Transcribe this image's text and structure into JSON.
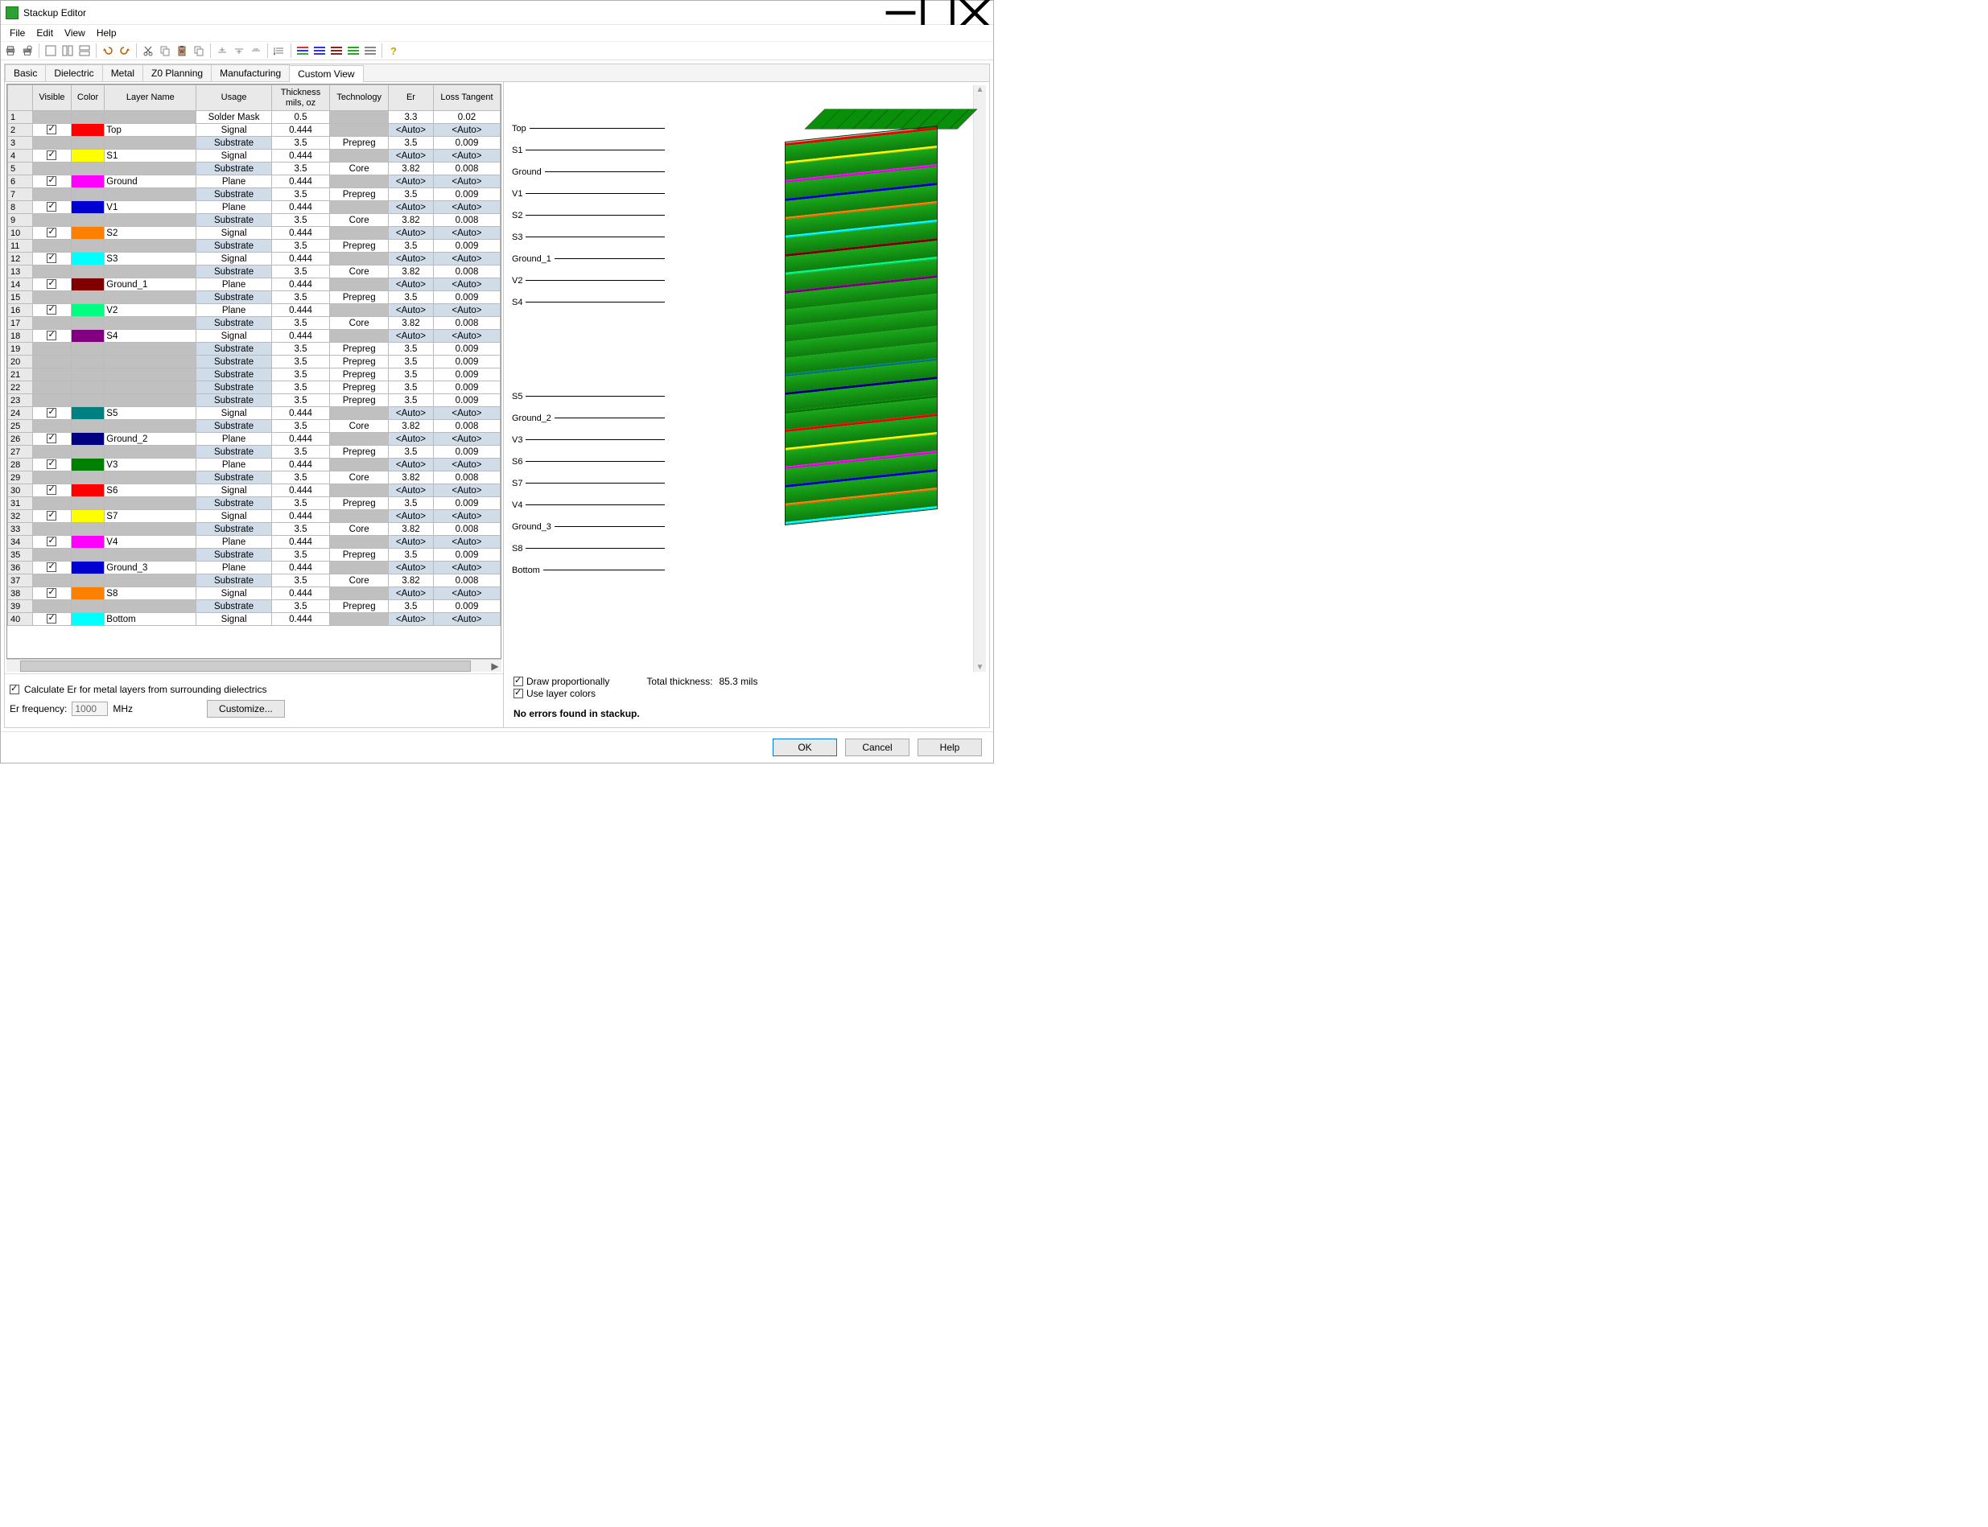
{
  "window": {
    "title": "Stackup Editor"
  },
  "menubar": [
    "File",
    "Edit",
    "View",
    "Help"
  ],
  "tabs": [
    "Basic",
    "Dielectric",
    "Metal",
    "Z0 Planning",
    "Manufacturing",
    "Custom View"
  ],
  "activeTab": 5,
  "columns": [
    "",
    "Visible",
    "Color",
    "Layer Name",
    "Usage",
    "Thickness\nmils, oz",
    "Technology",
    "Er",
    "Loss Tangent"
  ],
  "rows": [
    {
      "n": 1,
      "vis": null,
      "color": null,
      "name": "",
      "usage": "Solder Mask",
      "th": "0.5",
      "tech": "",
      "er": "3.3",
      "lt": "0.02",
      "kind": "mask"
    },
    {
      "n": 2,
      "vis": true,
      "color": "#ff0000",
      "name": "Top",
      "usage": "Signal",
      "th": "0.444",
      "tech": "",
      "er": "<Auto>",
      "lt": "<Auto>",
      "kind": "metal"
    },
    {
      "n": 3,
      "vis": null,
      "color": null,
      "name": "",
      "usage": "Substrate",
      "th": "3.5",
      "tech": "Prepreg",
      "er": "3.5",
      "lt": "0.009",
      "kind": "sub"
    },
    {
      "n": 4,
      "vis": true,
      "color": "#ffff00",
      "name": "S1",
      "usage": "Signal",
      "th": "0.444",
      "tech": "",
      "er": "<Auto>",
      "lt": "<Auto>",
      "kind": "metal"
    },
    {
      "n": 5,
      "vis": null,
      "color": null,
      "name": "",
      "usage": "Substrate",
      "th": "3.5",
      "tech": "Core",
      "er": "3.82",
      "lt": "0.008",
      "kind": "sub"
    },
    {
      "n": 6,
      "vis": true,
      "color": "#ff00ff",
      "name": "Ground",
      "usage": "Plane",
      "th": "0.444",
      "tech": "",
      "er": "<Auto>",
      "lt": "<Auto>",
      "kind": "metal"
    },
    {
      "n": 7,
      "vis": null,
      "color": null,
      "name": "",
      "usage": "Substrate",
      "th": "3.5",
      "tech": "Prepreg",
      "er": "3.5",
      "lt": "0.009",
      "kind": "sub"
    },
    {
      "n": 8,
      "vis": true,
      "color": "#0000d0",
      "name": "V1",
      "usage": "Plane",
      "th": "0.444",
      "tech": "",
      "er": "<Auto>",
      "lt": "<Auto>",
      "kind": "metal"
    },
    {
      "n": 9,
      "vis": null,
      "color": null,
      "name": "",
      "usage": "Substrate",
      "th": "3.5",
      "tech": "Core",
      "er": "3.82",
      "lt": "0.008",
      "kind": "sub"
    },
    {
      "n": 10,
      "vis": true,
      "color": "#ff8000",
      "name": "S2",
      "usage": "Signal",
      "th": "0.444",
      "tech": "",
      "er": "<Auto>",
      "lt": "<Auto>",
      "kind": "metal"
    },
    {
      "n": 11,
      "vis": null,
      "color": null,
      "name": "",
      "usage": "Substrate",
      "th": "3.5",
      "tech": "Prepreg",
      "er": "3.5",
      "lt": "0.009",
      "kind": "sub"
    },
    {
      "n": 12,
      "vis": true,
      "color": "#00ffff",
      "name": "S3",
      "usage": "Signal",
      "th": "0.444",
      "tech": "",
      "er": "<Auto>",
      "lt": "<Auto>",
      "kind": "metal"
    },
    {
      "n": 13,
      "vis": null,
      "color": null,
      "name": "",
      "usage": "Substrate",
      "th": "3.5",
      "tech": "Core",
      "er": "3.82",
      "lt": "0.008",
      "kind": "sub"
    },
    {
      "n": 14,
      "vis": true,
      "color": "#800000",
      "name": "Ground_1",
      "usage": "Plane",
      "th": "0.444",
      "tech": "",
      "er": "<Auto>",
      "lt": "<Auto>",
      "kind": "metal"
    },
    {
      "n": 15,
      "vis": null,
      "color": null,
      "name": "",
      "usage": "Substrate",
      "th": "3.5",
      "tech": "Prepreg",
      "er": "3.5",
      "lt": "0.009",
      "kind": "sub"
    },
    {
      "n": 16,
      "vis": true,
      "color": "#00ff80",
      "name": "V2",
      "usage": "Plane",
      "th": "0.444",
      "tech": "",
      "er": "<Auto>",
      "lt": "<Auto>",
      "kind": "metal"
    },
    {
      "n": 17,
      "vis": null,
      "color": null,
      "name": "",
      "usage": "Substrate",
      "th": "3.5",
      "tech": "Core",
      "er": "3.82",
      "lt": "0.008",
      "kind": "sub"
    },
    {
      "n": 18,
      "vis": true,
      "color": "#800080",
      "name": "S4",
      "usage": "Signal",
      "th": "0.444",
      "tech": "",
      "er": "<Auto>",
      "lt": "<Auto>",
      "kind": "metal"
    },
    {
      "n": 19,
      "vis": null,
      "color": null,
      "name": "",
      "usage": "Substrate",
      "th": "3.5",
      "tech": "Prepreg",
      "er": "3.5",
      "lt": "0.009",
      "kind": "sub"
    },
    {
      "n": 20,
      "vis": null,
      "color": null,
      "name": "",
      "usage": "Substrate",
      "th": "3.5",
      "tech": "Prepreg",
      "er": "3.5",
      "lt": "0.009",
      "kind": "sub"
    },
    {
      "n": 21,
      "vis": null,
      "color": null,
      "name": "",
      "usage": "Substrate",
      "th": "3.5",
      "tech": "Prepreg",
      "er": "3.5",
      "lt": "0.009",
      "kind": "sub"
    },
    {
      "n": 22,
      "vis": null,
      "color": null,
      "name": "",
      "usage": "Substrate",
      "th": "3.5",
      "tech": "Prepreg",
      "er": "3.5",
      "lt": "0.009",
      "kind": "sub"
    },
    {
      "n": 23,
      "vis": null,
      "color": null,
      "name": "",
      "usage": "Substrate",
      "th": "3.5",
      "tech": "Prepreg",
      "er": "3.5",
      "lt": "0.009",
      "kind": "sub"
    },
    {
      "n": 24,
      "vis": true,
      "color": "#008080",
      "name": "S5",
      "usage": "Signal",
      "th": "0.444",
      "tech": "",
      "er": "<Auto>",
      "lt": "<Auto>",
      "kind": "metal"
    },
    {
      "n": 25,
      "vis": null,
      "color": null,
      "name": "",
      "usage": "Substrate",
      "th": "3.5",
      "tech": "Core",
      "er": "3.82",
      "lt": "0.008",
      "kind": "sub"
    },
    {
      "n": 26,
      "vis": true,
      "color": "#000080",
      "name": "Ground_2",
      "usage": "Plane",
      "th": "0.444",
      "tech": "",
      "er": "<Auto>",
      "lt": "<Auto>",
      "kind": "metal"
    },
    {
      "n": 27,
      "vis": null,
      "color": null,
      "name": "",
      "usage": "Substrate",
      "th": "3.5",
      "tech": "Prepreg",
      "er": "3.5",
      "lt": "0.009",
      "kind": "sub"
    },
    {
      "n": 28,
      "vis": true,
      "color": "#008000",
      "name": "V3",
      "usage": "Plane",
      "th": "0.444",
      "tech": "",
      "er": "<Auto>",
      "lt": "<Auto>",
      "kind": "metal"
    },
    {
      "n": 29,
      "vis": null,
      "color": null,
      "name": "",
      "usage": "Substrate",
      "th": "3.5",
      "tech": "Core",
      "er": "3.82",
      "lt": "0.008",
      "kind": "sub"
    },
    {
      "n": 30,
      "vis": true,
      "color": "#ff0000",
      "name": "S6",
      "usage": "Signal",
      "th": "0.444",
      "tech": "",
      "er": "<Auto>",
      "lt": "<Auto>",
      "kind": "metal"
    },
    {
      "n": 31,
      "vis": null,
      "color": null,
      "name": "",
      "usage": "Substrate",
      "th": "3.5",
      "tech": "Prepreg",
      "er": "3.5",
      "lt": "0.009",
      "kind": "sub"
    },
    {
      "n": 32,
      "vis": true,
      "color": "#ffff00",
      "name": "S7",
      "usage": "Signal",
      "th": "0.444",
      "tech": "",
      "er": "<Auto>",
      "lt": "<Auto>",
      "kind": "metal"
    },
    {
      "n": 33,
      "vis": null,
      "color": null,
      "name": "",
      "usage": "Substrate",
      "th": "3.5",
      "tech": "Core",
      "er": "3.82",
      "lt": "0.008",
      "kind": "sub"
    },
    {
      "n": 34,
      "vis": true,
      "color": "#ff00ff",
      "name": "V4",
      "usage": "Plane",
      "th": "0.444",
      "tech": "",
      "er": "<Auto>",
      "lt": "<Auto>",
      "kind": "metal"
    },
    {
      "n": 35,
      "vis": null,
      "color": null,
      "name": "",
      "usage": "Substrate",
      "th": "3.5",
      "tech": "Prepreg",
      "er": "3.5",
      "lt": "0.009",
      "kind": "sub"
    },
    {
      "n": 36,
      "vis": true,
      "color": "#0000d0",
      "name": "Ground_3",
      "usage": "Plane",
      "th": "0.444",
      "tech": "",
      "er": "<Auto>",
      "lt": "<Auto>",
      "kind": "metal"
    },
    {
      "n": 37,
      "vis": null,
      "color": null,
      "name": "",
      "usage": "Substrate",
      "th": "3.5",
      "tech": "Core",
      "er": "3.82",
      "lt": "0.008",
      "kind": "sub"
    },
    {
      "n": 38,
      "vis": true,
      "color": "#ff8000",
      "name": "S8",
      "usage": "Signal",
      "th": "0.444",
      "tech": "",
      "er": "<Auto>",
      "lt": "<Auto>",
      "kind": "metal"
    },
    {
      "n": 39,
      "vis": null,
      "color": null,
      "name": "",
      "usage": "Substrate",
      "th": "3.5",
      "tech": "Prepreg",
      "er": "3.5",
      "lt": "0.009",
      "kind": "sub"
    },
    {
      "n": 40,
      "vis": true,
      "color": "#00ffff",
      "name": "Bottom",
      "usage": "Signal",
      "th": "0.444",
      "tech": "",
      "er": "<Auto>",
      "lt": "<Auto>",
      "kind": "metal"
    }
  ],
  "footer": {
    "calcEr_label": "Calculate Er for metal layers from surrounding dielectrics",
    "calcEr_checked": true,
    "erfreq_label": "Er frequency:",
    "erfreq_value": "1000",
    "erfreq_unit": "MHz",
    "customize_label": "Customize..."
  },
  "right": {
    "drawprop_label": "Draw proportionally",
    "drawprop_checked": true,
    "uselayer_label": "Use layer colors",
    "uselayer_checked": true,
    "totalthick_label": "Total thickness:",
    "totalthick_value": "85.3 mils",
    "status": "No errors found in stackup."
  },
  "vizLabels": [
    "Top",
    "S1",
    "Ground",
    "V1",
    "S2",
    "S3",
    "Ground_1",
    "V2",
    "S4",
    "S5",
    "Ground_2",
    "V3",
    "S6",
    "S7",
    "V4",
    "Ground_3",
    "S8",
    "Bottom"
  ],
  "buttons": {
    "ok": "OK",
    "cancel": "Cancel",
    "help": "Help"
  }
}
